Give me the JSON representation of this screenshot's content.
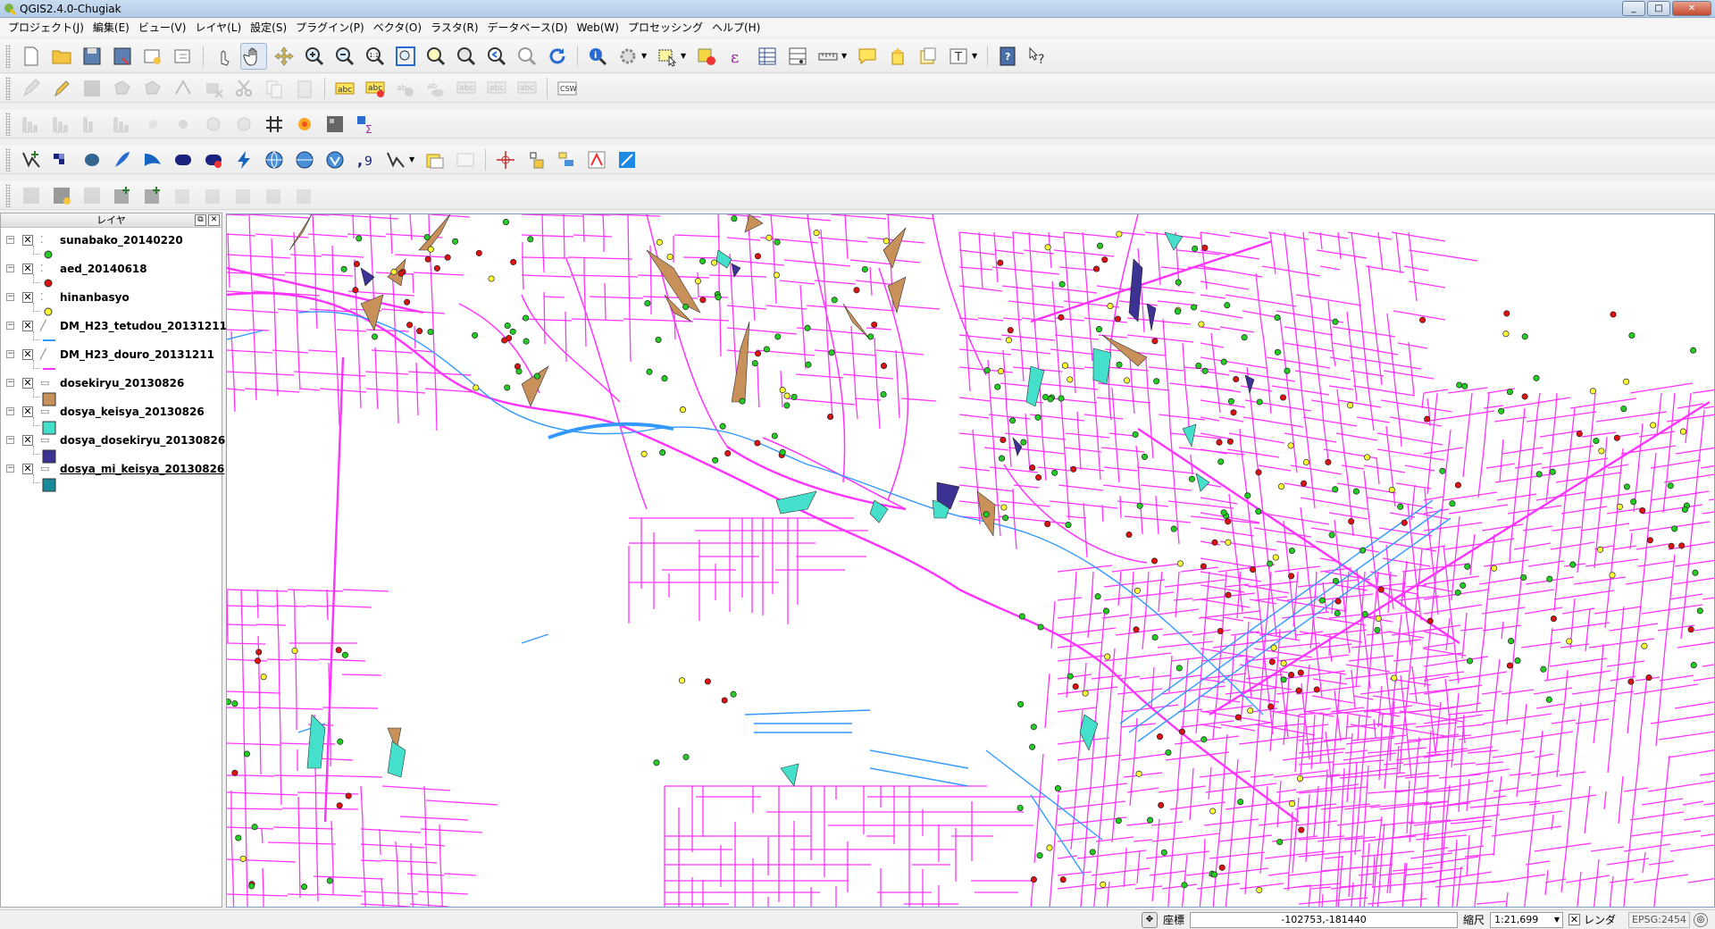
{
  "window": {
    "title": "QGIS2.4.0-Chugiak",
    "controls": [
      "minimize",
      "maximize",
      "close"
    ]
  },
  "menu": [
    "プロジェクト(J)",
    "編集(E)",
    "ビュー(V)",
    "レイヤ(L)",
    "設定(S)",
    "プラグイン(P)",
    "ベクタ(O)",
    "ラスタ(R)",
    "データベース(D)",
    "Web(W)",
    "プロセッシング",
    "ヘルプ(H)"
  ],
  "layers_panel": {
    "title": "レイヤ",
    "layers": [
      {
        "name": "sunabako_20140220",
        "type": "point",
        "visible": true,
        "symbol_color": "#22cc22"
      },
      {
        "name": "aed_20140618",
        "type": "point",
        "visible": true,
        "symbol_color": "#dd1111"
      },
      {
        "name": "hinanbasyo",
        "type": "point",
        "visible": true,
        "symbol_color": "#ffff33"
      },
      {
        "name": "DM_H23_tetudou_20131211",
        "type": "line",
        "visible": true,
        "symbol_color": "#3399ff"
      },
      {
        "name": "DM_H23_douro_20131211",
        "type": "line",
        "visible": true,
        "symbol_color": "#ff33ff"
      },
      {
        "name": "dosekiryu_20130826",
        "type": "polygon",
        "visible": true,
        "symbol_color": "#c8915a"
      },
      {
        "name": "dosya_keisya_20130826",
        "type": "polygon",
        "visible": true,
        "symbol_color": "#44e0cc"
      },
      {
        "name": "dosya_dosekiryu_20130826",
        "type": "polygon",
        "visible": true,
        "symbol_color": "#3c3294"
      },
      {
        "name": "dosya_mi_keisya_20130826",
        "type": "polygon",
        "visible": true,
        "symbol_color": "#1a8a9a"
      }
    ]
  },
  "colors": {
    "roads": "#ff33ff",
    "rail": "#3399ff",
    "dosekiryu": "#c8915a",
    "keisya": "#44e0cc",
    "dosya_dosekiryu": "#3c3294",
    "green_point": "#22cc22",
    "red_point": "#dd1111",
    "yellow_point": "#ffff33"
  },
  "status": {
    "coord_label": "座標",
    "coord_value": "-102753,-181440",
    "scale_label": "縮尺",
    "scale_value": "1:21,699",
    "render_label": "レンダ",
    "epsg": "EPSG:2454"
  }
}
